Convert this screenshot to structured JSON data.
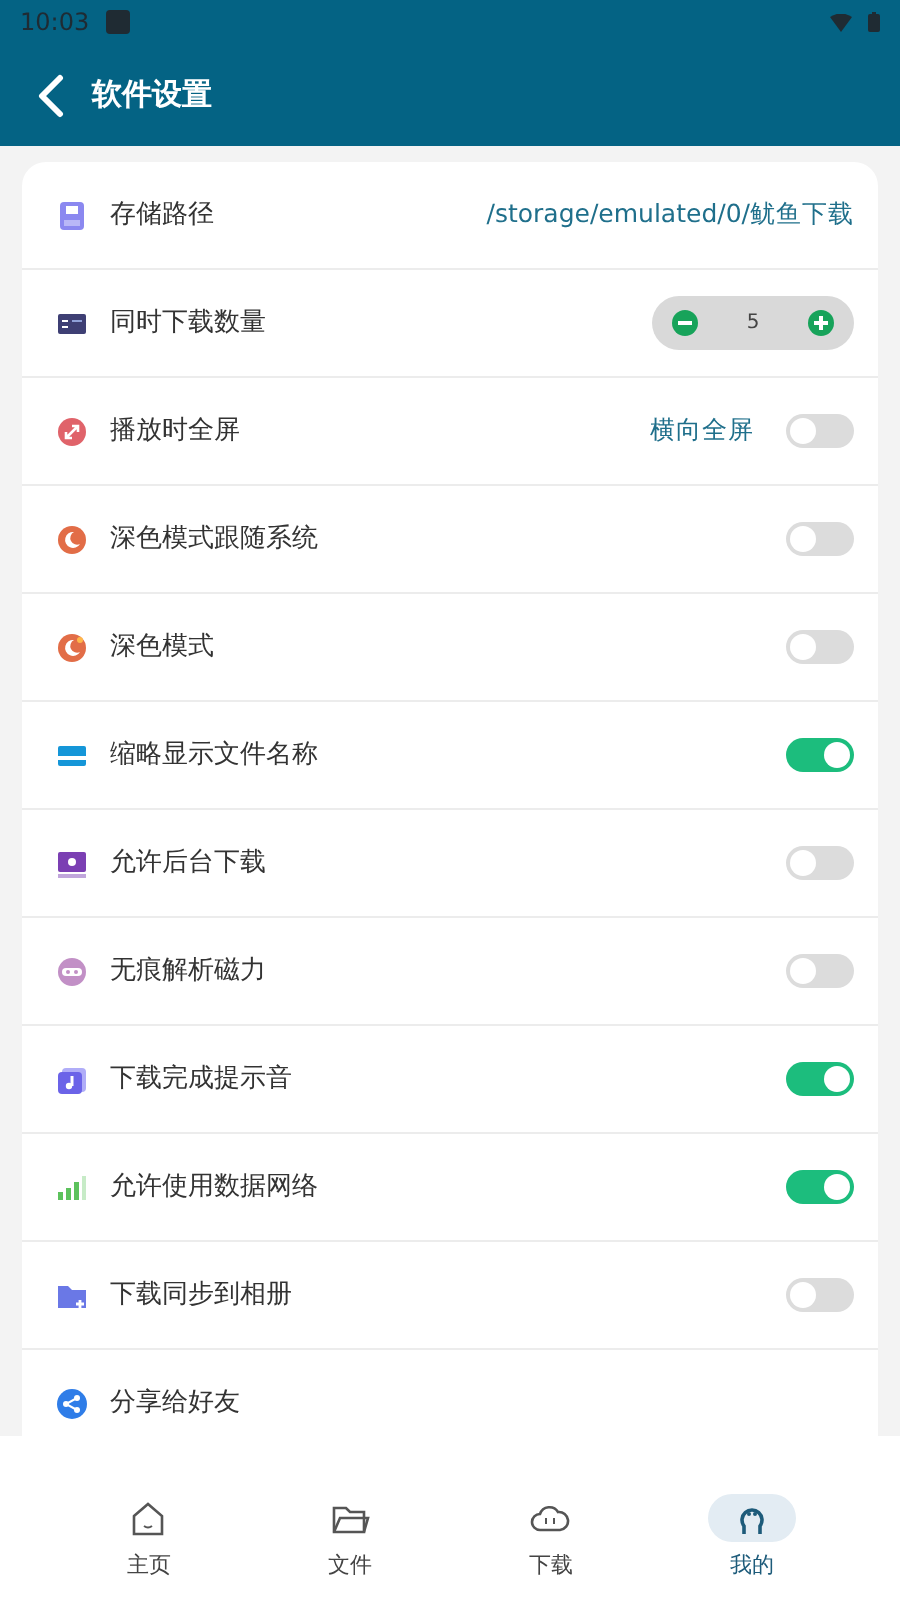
{
  "status_bar": {
    "time": "10:03"
  },
  "app_bar": {
    "title": "软件设置"
  },
  "settings": [
    {
      "kind": "link",
      "label": "存储路径",
      "value": "/storage/emulated/0/鱿鱼下载"
    },
    {
      "kind": "stepper",
      "label": "同时下载数量",
      "value": "5"
    },
    {
      "kind": "toggle",
      "label": "播放时全屏",
      "value": "横向全屏",
      "on": false
    },
    {
      "kind": "toggle",
      "label": "深色模式跟随系统",
      "on": false
    },
    {
      "kind": "toggle",
      "label": "深色模式",
      "on": false
    },
    {
      "kind": "toggle",
      "label": "缩略显示文件名称",
      "on": true
    },
    {
      "kind": "toggle",
      "label": "允许后台下载",
      "on": false
    },
    {
      "kind": "toggle",
      "label": "无痕解析磁力",
      "on": false
    },
    {
      "kind": "toggle",
      "label": "下载完成提示音",
      "on": true
    },
    {
      "kind": "toggle",
      "label": "允许使用数据网络",
      "on": true
    },
    {
      "kind": "toggle",
      "label": "下载同步到相册",
      "on": false
    },
    {
      "kind": "plain",
      "label": "分享给好友"
    }
  ],
  "bottom_nav": [
    {
      "label": "主页",
      "selected": false
    },
    {
      "label": "文件",
      "selected": false
    },
    {
      "label": "下载",
      "selected": false
    },
    {
      "label": "我的",
      "selected": true
    }
  ]
}
